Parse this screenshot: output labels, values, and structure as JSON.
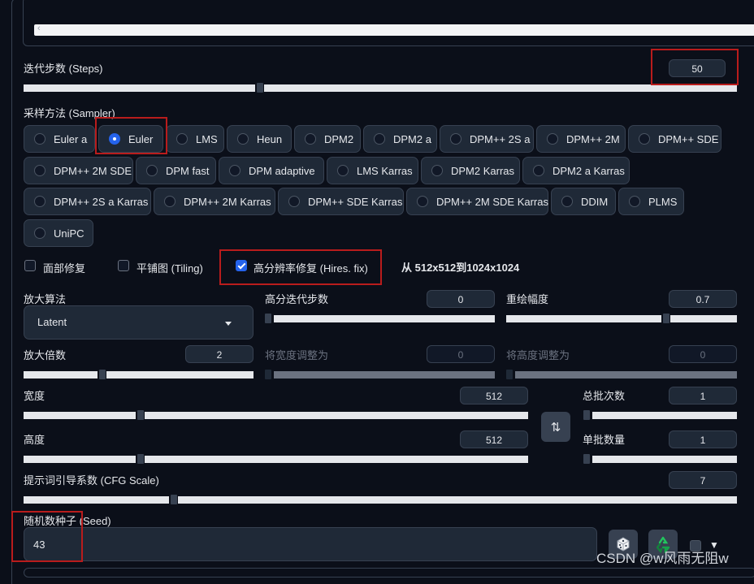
{
  "steps": {
    "label": "迭代步数 (Steps)",
    "value": "50",
    "fraction": 0.33
  },
  "sampler": {
    "label": "采样方法 (Sampler)",
    "selected": "Euler",
    "options": [
      "Euler a",
      "Euler",
      "LMS",
      "Heun",
      "DPM2",
      "DPM2 a",
      "DPM++ 2S a",
      "DPM++ 2M",
      "DPM++ SDE",
      "DPM++ 2M SDE",
      "DPM fast",
      "DPM adaptive",
      "LMS Karras",
      "DPM2 Karras",
      "DPM2 a Karras",
      "DPM++ 2S a Karras",
      "DPM++ 2M Karras",
      "DPM++ SDE Karras",
      "DPM++ 2M SDE Karras",
      "DDIM",
      "PLMS",
      "UniPC"
    ]
  },
  "checkboxes": {
    "face_restore": {
      "label": "面部修复",
      "checked": false
    },
    "tiling": {
      "label": "平铺图 (Tiling)",
      "checked": false
    },
    "hires_fix": {
      "label": "高分辨率修复 (Hires. fix)",
      "checked": true
    }
  },
  "hires_info": "从 512x512到1024x1024",
  "upscaler": {
    "label": "放大算法",
    "value": "Latent"
  },
  "hires_steps": {
    "label": "高分迭代步数",
    "value": "0",
    "fraction": 0.0
  },
  "denoise": {
    "label": "重绘幅度",
    "value": "0.7",
    "fraction": 0.7
  },
  "upscale_by": {
    "label": "放大倍数",
    "value": "2",
    "fraction": 0.33
  },
  "resize_width": {
    "label": "将宽度调整为",
    "value": "0",
    "fraction": 0.0
  },
  "resize_height": {
    "label": "将高度调整为",
    "value": "0",
    "fraction": 0.0
  },
  "width": {
    "label": "宽度",
    "value": "512",
    "fraction": 0.23
  },
  "height": {
    "label": "高度",
    "value": "512",
    "fraction": 0.23
  },
  "swap_icon": "swap-vertical-icon",
  "batch_count": {
    "label": "总批次数",
    "value": "1",
    "fraction": 0.0
  },
  "batch_size": {
    "label": "单批数量",
    "value": "1",
    "fraction": 0.0
  },
  "cfg": {
    "label": "提示词引导系数 (CFG Scale)",
    "value": "7",
    "fraction": 0.21
  },
  "seed": {
    "label": "随机数种子 (Seed)",
    "value": "43"
  },
  "seed_buttons": {
    "random_icon": "dice-icon",
    "reuse_icon": "recycle-icon",
    "extra_caret": "▼"
  },
  "watermark": "CSDN @w风雨无阻w",
  "colors": {
    "accent": "#2563eb",
    "highlight": "#b91c1c",
    "background": "#0b0f19"
  }
}
